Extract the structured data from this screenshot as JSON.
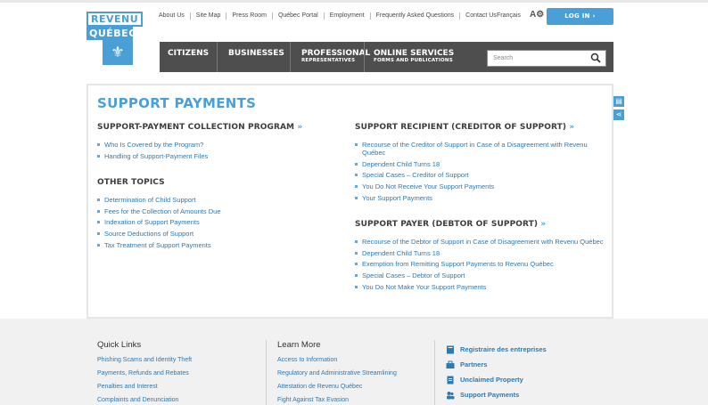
{
  "header": {
    "logo_line1": "REVENU",
    "logo_line2": "QUÉBEC",
    "top_links": [
      "About Us",
      "Site Map",
      "Press Room",
      "Québec Portal",
      "Employment",
      "Frequently Asked Questions",
      "Contact Us"
    ],
    "language": "Français",
    "accessibility_glyph": "A",
    "login_label": "LOG IN",
    "login_arrow": "›",
    "search_placeholder": "Search"
  },
  "nav": {
    "items": [
      {
        "label": "CITIZENS",
        "sub": ""
      },
      {
        "label": "BUSINESSES",
        "sub": ""
      },
      {
        "label": "PROFESSIONAL",
        "sub": "REPRESENTATIVES"
      },
      {
        "label": "ONLINE SERVICES",
        "sub": "FORMS AND PUBLICATIONS"
      }
    ]
  },
  "main": {
    "title": "SUPPORT PAYMENTS",
    "arrow": "»",
    "left": {
      "section1": {
        "heading": "SUPPORT-PAYMENT COLLECTION PROGRAM",
        "links": [
          "Who Is Covered by the Program?",
          "Handling of Support-Payment Files"
        ]
      },
      "section2": {
        "heading": "OTHER TOPICS",
        "links": [
          "Determination of Child Support",
          "Fees for the Collection of Amounts Due",
          "Indexation of Support Payments",
          "Source Deductions of Support",
          "Tax Treatment of Support Payments"
        ]
      }
    },
    "right": {
      "section1": {
        "heading": "SUPPORT RECIPIENT (CREDITOR OF SUPPORT)",
        "links": [
          "Recourse of the Creditor of Support in Case of a Disagreement with Revenu Québec",
          "Dependent Child Turns 18",
          "Special Cases – Creditor of Support",
          "You Do Not Receive Your Support Payments",
          "Your Support Payments"
        ]
      },
      "section2": {
        "heading": "SUPPORT PAYER (DEBTOR OF SUPPORT)",
        "links": [
          "Recourse of the Debtor of Support in Case of Disagreement with Revenu Québec",
          "Dependent Child Turns 18",
          "Exemption from Remitting Support Payments to Revenu Québec",
          "Special Cases – Debtor of Support",
          "You Do Not Make Your Support Payments"
        ]
      }
    }
  },
  "footer": {
    "quick_links": {
      "title": "Quick Links",
      "links": [
        "Phishing Scams and Identity Theft",
        "Payments, Refunds and Rebates",
        "Penalties and Interest",
        "Complaints and Denunciation"
      ]
    },
    "learn_more": {
      "title": "Learn More",
      "links": [
        "Access to Information",
        "Regulatory and Administrative Streamlining",
        "Attestation de Revenu Québec",
        "Fight Against Tax Evasion"
      ]
    },
    "featured": [
      "Registraire des entreprises",
      "Partners",
      "Unclaimed Property",
      "Support Payments"
    ]
  },
  "colors": {
    "accent": "#4aa0d6",
    "nav_bg": "#4e4e4e",
    "link": "#2b79b5",
    "footer_bg": "#f1f1f1"
  }
}
